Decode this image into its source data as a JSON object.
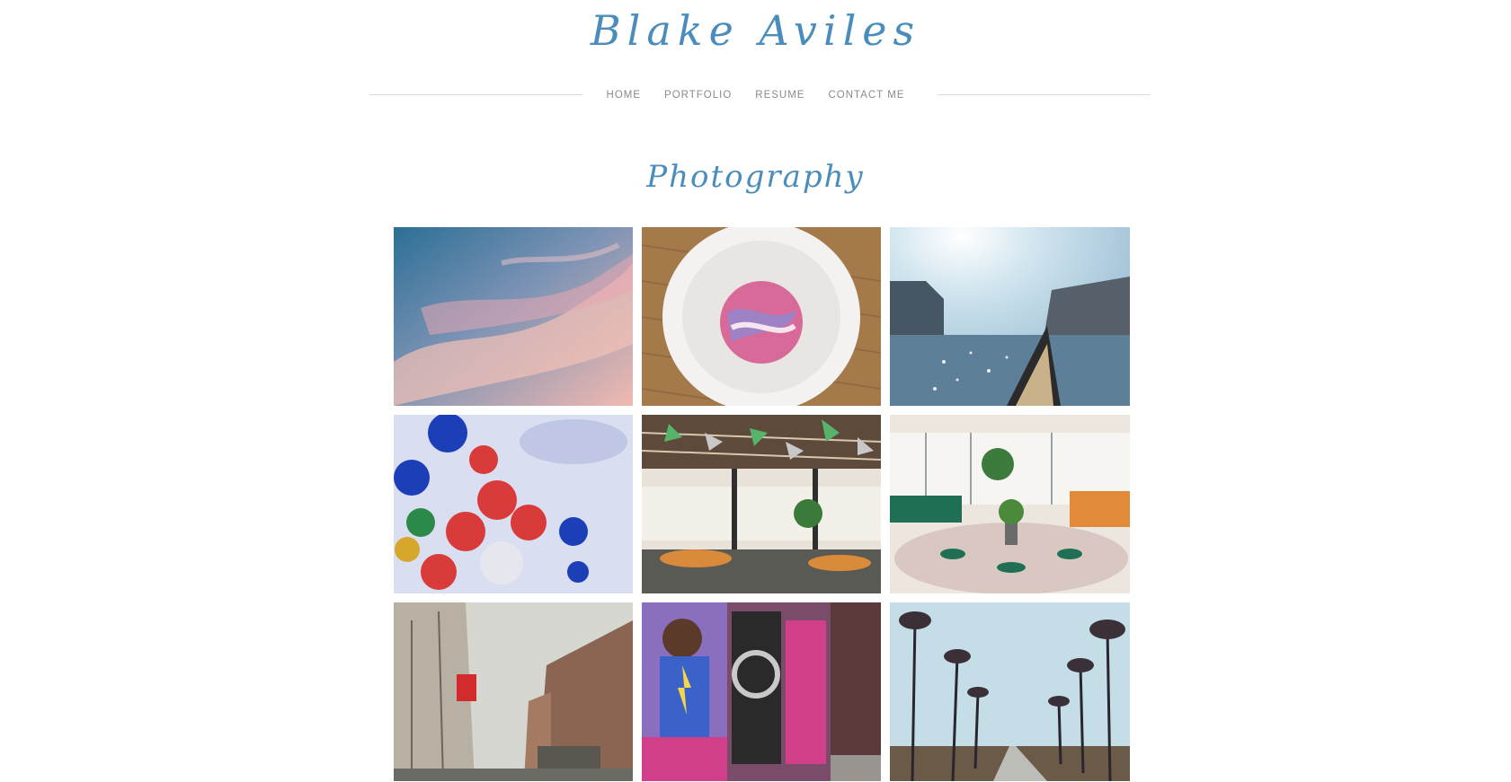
{
  "header": {
    "site_title": "Blake Aviles"
  },
  "nav": {
    "items": [
      {
        "label": "HOME"
      },
      {
        "label": "PORTFOLIO"
      },
      {
        "label": "RESUME"
      },
      {
        "label": "CONTACT ME"
      }
    ]
  },
  "main": {
    "section_title": "Photography"
  },
  "colors": {
    "accent": "#4a8cbb",
    "nav_text": "#8a8a8a",
    "divider": "#d9d9d9"
  }
}
